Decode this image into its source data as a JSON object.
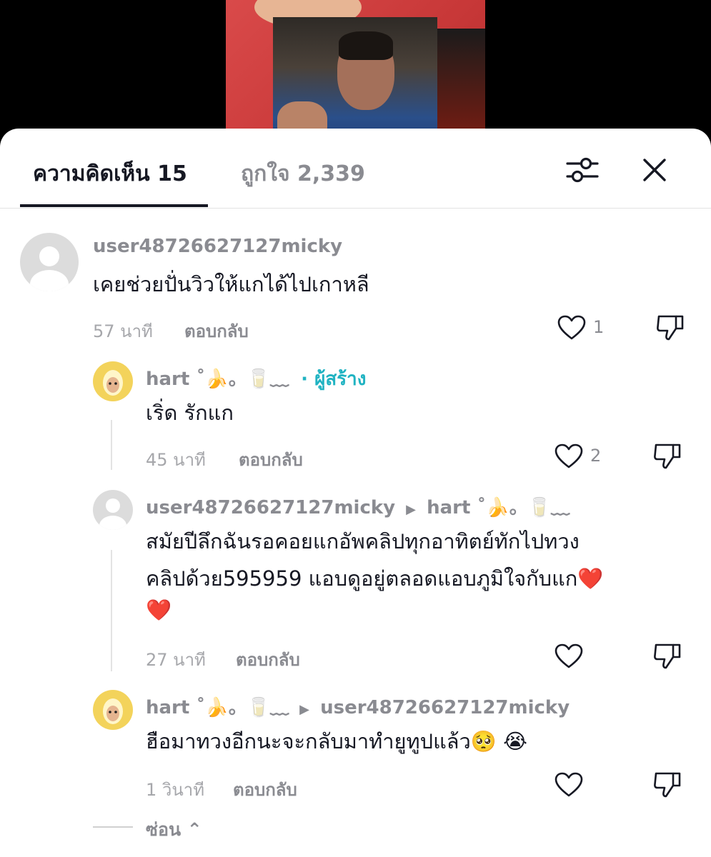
{
  "tabs": {
    "comments_label": "ความคิดเห็น 15",
    "likes_label": "ถูกใจ 2,339"
  },
  "icons": {
    "filter": "sliders-icon",
    "close": "close-icon",
    "like": "heart-icon",
    "dislike": "thumbs-down-icon"
  },
  "comments": [
    {
      "username": "user48726627127micky",
      "text": "เคยช่วยปั่นวิวให้แกได้ไปเกาหลี",
      "time": "57 นาที",
      "reply_label": "ตอบกลับ",
      "likes": "1"
    },
    {
      "username": "hart ˚🍌。🥛﹏",
      "creator_tag": "· ผู้สร้าง",
      "text": "เริ่ด รักแก",
      "time": "45 นาที",
      "reply_label": "ตอบกลับ",
      "likes": "2"
    },
    {
      "username": "user48726627127micky",
      "reply_to": "hart ˚🍌。🥛﹏",
      "text_line1": "สมัยปีลึกฉันรอคอยแกอัพคลิปทุกอาทิตย์ทักไปทวง",
      "text_line2": "คลิปด้วย595959 แอบดูอยู่ตลอดแอบภูมิใจกับแก❤️",
      "text_line3": "❤️",
      "time": "27 นาที",
      "reply_label": "ตอบกลับ"
    },
    {
      "username": "hart ˚🍌。🥛﹏",
      "reply_to": "user48726627127micky",
      "text": "ฮือมาทวงอีกนะจะกลับมาทำยูทูปแล้ว🥺 😭",
      "time": "1 วินาที",
      "reply_label": "ตอบกลับ"
    }
  ],
  "hide_label": "ซ่อน ⌃"
}
